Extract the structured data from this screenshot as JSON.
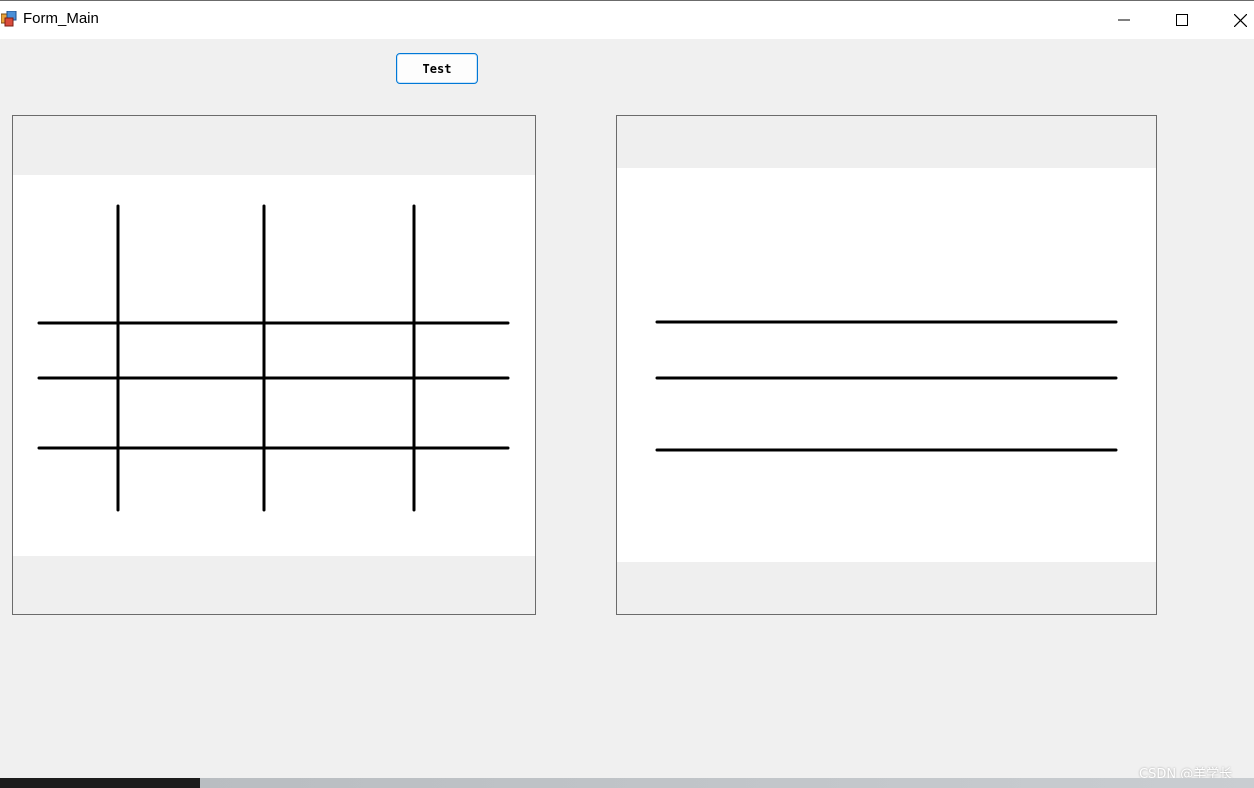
{
  "window": {
    "title": "Form_Main",
    "controls": {
      "minimize": "minimize-icon",
      "maximize": "maximize-icon",
      "close": "close-icon"
    }
  },
  "toolbar": {
    "test_label": "Test"
  },
  "panels": [
    {
      "name": "left-picture",
      "content": "grid: 3 vertical + 3 horizontal strokes"
    },
    {
      "name": "right-picture",
      "content": "3 horizontal strokes"
    }
  ],
  "watermark": "CSDN @羊学长",
  "colors": {
    "window_bg": "#f0f0f0",
    "canvas_bg": "#ffffff",
    "stroke": "#000000",
    "accent": "#0078d7"
  }
}
